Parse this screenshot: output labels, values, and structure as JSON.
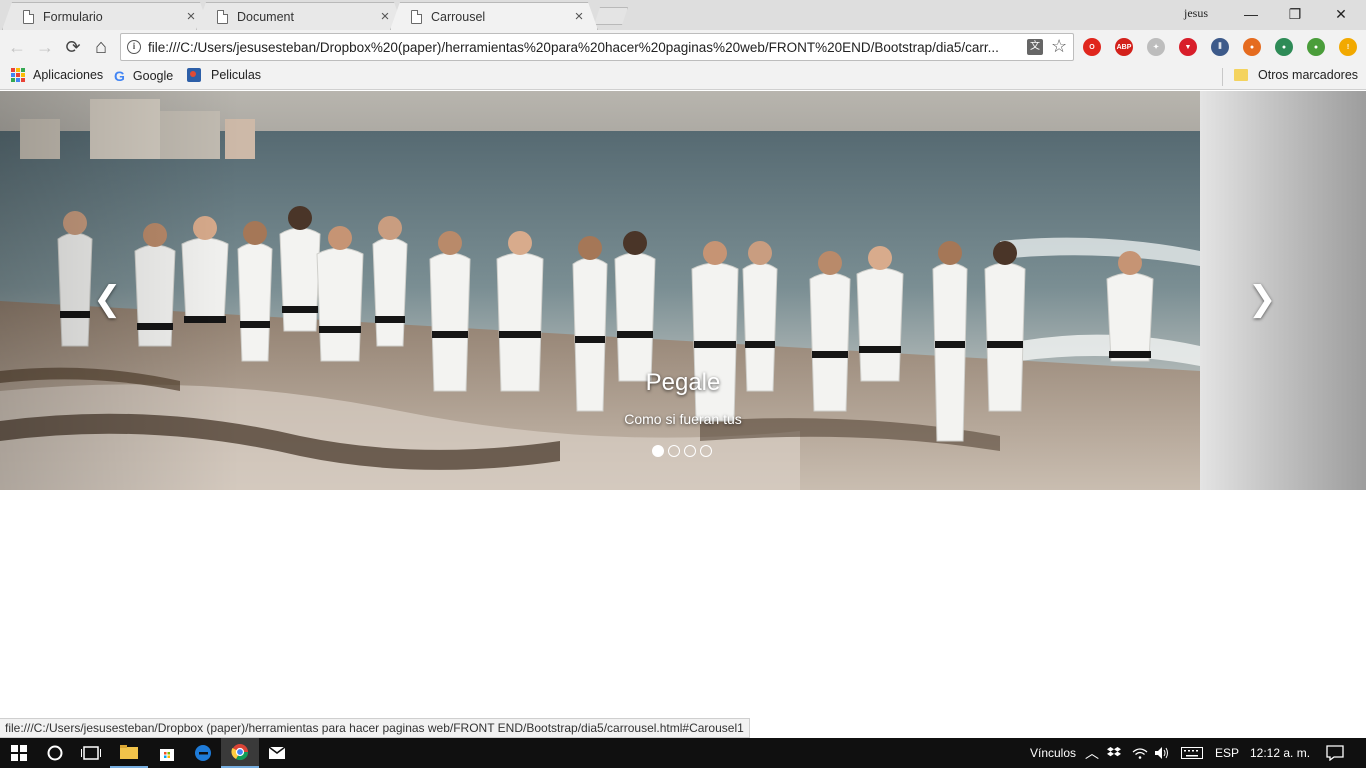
{
  "browser": {
    "tabs": [
      {
        "title": "Formulario",
        "close": "×"
      },
      {
        "title": "Document",
        "close": "×"
      },
      {
        "title": "Carrousel",
        "close": "×"
      }
    ],
    "profile_name": "jesus",
    "window_controls": {
      "minimize": "—",
      "restore": "❐",
      "close": "✕"
    },
    "toolbar": {
      "back": "←",
      "forward": "→",
      "reload": "⟳",
      "home": "⌂",
      "url": "file:///C:/Users/jesusesteban/Dropbox%20(paper)/herramientas%20para%20hacer%20paginas%20web/FRONT%20END/Bootstrap/dia5/carr...",
      "info_glyph": "i",
      "translate_glyph": "文",
      "star_glyph": "☆"
    },
    "extensions": [
      {
        "name": "opera-icon",
        "color": "#e0261d",
        "glyph": "O"
      },
      {
        "name": "adblock-plus-icon",
        "color": "#d3211b",
        "glyph": "ABP"
      },
      {
        "name": "puzzle-extension-icon",
        "color": "#bdbdbd",
        "glyph": "✦"
      },
      {
        "name": "shield-icon",
        "color": "#d81e2a",
        "glyph": "▼"
      },
      {
        "name": "equalizer-icon",
        "color": "#3d5a8a",
        "glyph": "⫼"
      },
      {
        "name": "firefox-icon",
        "color": "#e56b1f",
        "glyph": "●"
      },
      {
        "name": "globe-icon",
        "color": "#2e8b57",
        "glyph": "●"
      },
      {
        "name": "chrome-canary-icon",
        "color": "#4a9d3a",
        "glyph": "●"
      },
      {
        "name": "warning-icon",
        "color": "#f2a900",
        "glyph": "!"
      }
    ],
    "bookmarks": {
      "apps": "Aplicaciones",
      "google": "Google",
      "peliculas": "Peliculas",
      "otros": "Otros marcadores",
      "google_glyph": "G"
    }
  },
  "carousel": {
    "caption_title": "Pegale",
    "caption_text": "Como si fueran tus",
    "prev_glyph": "❮",
    "next_glyph": "❯",
    "indicator_count": 4,
    "active_indicator": 1
  },
  "status_bar": {
    "text": "file:///C:/Users/jesusesteban/Dropbox (paper)/herramientas para hacer paginas web/FRONT END/Bootstrap/dia5/carrousel.html#Carousel1"
  },
  "taskbar": {
    "vinculos": "Vínculos",
    "language": "ESP",
    "clock": "12:12 a. m."
  }
}
